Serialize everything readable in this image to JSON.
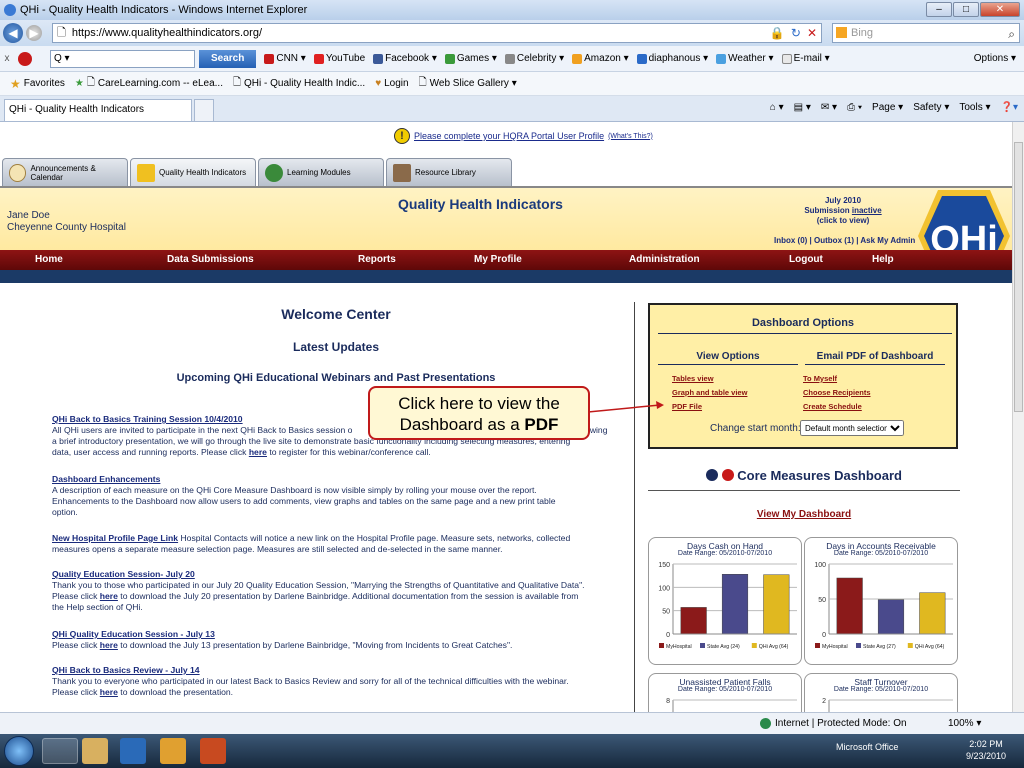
{
  "browser": {
    "window_title": "QHi - Quality Health Indicators - Windows Internet Explorer",
    "url_prefix": "https://www.",
    "url_domain": "qualityhealthindicators.org/",
    "search_placeholder": "Bing",
    "toolbar": {
      "search_label": "Search",
      "items": [
        "CNN ▾",
        "YouTube",
        "Facebook ▾",
        "Games ▾",
        "Celebrity ▾",
        "Amazon ▾",
        "diaphanous ▾",
        "Weather ▾",
        "E-mail ▾"
      ],
      "options": "Options ▾"
    },
    "favorites": {
      "label": "Favorites",
      "items": [
        "CareLearning.com -- eLea...",
        "QHi - Quality Health Indic...",
        "Login",
        "Web Slice Gallery ▾"
      ]
    },
    "tab_label": "QHi - Quality Health Indicators",
    "commands": [
      "Page ▾",
      "Safety ▾",
      "Tools ▾"
    ],
    "status": {
      "zone": "Internet | Protected Mode: On",
      "zoom": "100% ▾"
    }
  },
  "notice": {
    "text": "Please complete your HQRA Portal User Profile",
    "small": "(What's This?)"
  },
  "app_tabs": [
    "Announcements & Calendar",
    "Quality Health Indicators",
    "Learning Modules",
    "Resource Library"
  ],
  "header": {
    "user_name": "Jane Doe",
    "hospital": "Cheyenne County Hospital",
    "title": "Quality Health Indicators",
    "submission_line1": "July 2010",
    "submission_line2a": "Submission ",
    "submission_line2b": "inactive",
    "submission_line3": "(click to view)",
    "inbox": "Inbox (0) | Outbox (1) | Ask My Admin",
    "logo_text": "QHi"
  },
  "menu": [
    "Home",
    "Data Submissions",
    "Reports",
    "My Profile",
    "Administration",
    "Logout",
    "Help"
  ],
  "welcome": {
    "title": "Welcome Center",
    "latest": "Latest Updates",
    "upcoming": "Upcoming QHi Educational Webinars and Past Presentations",
    "news": [
      {
        "title": "QHi Back to Basics Training Session 10/4/2010",
        "body1": "All QHi users are invited to participate in the next QHi Back to Basics session o",
        "body1b": "ollowing",
        "body2": "a brief introductory presentation, we will go through the live site to demonstrate basic functionality including selecting measures, entering",
        "body3": "data, user access and running reports. Please click ",
        "link": "here",
        "body4": " to register for this webinar/conference call."
      },
      {
        "title": "Dashboard Enhancements",
        "body1": "A description of each measure on the QHi Core Measure Dashboard is now visible simply by rolling your mouse over the report.",
        "body2": "Enhancements to the Dashboard now allow users to add comments, view graphs and tables on the same page and a new print table",
        "body3": "option."
      },
      {
        "title": "New Hospital Profile Page Link",
        "body1": " Hospital Contacts will notice a new link on the Hospital Profile page. Measure sets, networks, collected",
        "body2": "measures opens a separate measure selection page. Measures are still selected and de-selected in the same manner."
      },
      {
        "title": "Quality Education Session- July 20",
        "body1": "Thank you to those who participated in our July 20 Quality Education Session, \"Marrying the Strengths of Quantitative and Qualitative Data\".",
        "body2a": "Please click ",
        "link": "here",
        "body2b": " to download the July 20 presentation by Darlene Bainbridge. Additional documentation from the session is available from",
        "body3": "the Help section of QHi."
      },
      {
        "title": "QHi Quality Education Session - July 13",
        "body1a": "Please click ",
        "link": "here",
        "body1b": " to download the July 13 presentation by Darlene Bainbridge, \"Moving from Incidents to Great Catches\"."
      },
      {
        "title": "QHi Back to Basics Review - July 14",
        "body1": "Thank you to everyone who participated in our latest Back to Basics Review and sorry for all of the technical difficulties with the webinar.",
        "body2a": "Please click ",
        "link": "here",
        "body2b": " to download the presentation."
      }
    ]
  },
  "dashboard_options": {
    "title": "Dashboard Options",
    "view_title": "View Options",
    "email_title": "Email PDF of Dashboard",
    "view_links": [
      "Tables view",
      "Graph and table view",
      "PDF File"
    ],
    "email_links": [
      "To Myself",
      "Choose Recipients",
      "Create Schedule"
    ],
    "start_label": "Change start month:",
    "start_value": "Default month selection"
  },
  "core": {
    "title": "Core Measures Dashboard",
    "view_link": "View My Dashboard"
  },
  "callout": {
    "line1": "Click here to view the",
    "line2": "Dashboard as a ",
    "bold": "PDF"
  },
  "chart_data": [
    {
      "type": "bar",
      "title": "Days Cash on Hand",
      "subtitle": "Date Range: 05/2010-07/2010",
      "categories": [
        "MyHospital",
        "State Avg (24)",
        "QHi Avg (64)"
      ],
      "values": [
        57,
        128,
        127
      ],
      "ylim": [
        0,
        150
      ],
      "ticks": [
        0,
        50,
        100,
        150
      ],
      "colors": [
        "#8b1a1a",
        "#4a4a8c",
        "#e0b820"
      ],
      "grid": true
    },
    {
      "type": "bar",
      "title": "Days in Accounts Receivable",
      "subtitle": "Date Range: 05/2010-07/2010",
      "categories": [
        "MyHospital",
        "State Avg (27)",
        "QHi Avg (64)"
      ],
      "values": [
        80,
        49,
        59
      ],
      "ylim": [
        0,
        100
      ],
      "ticks": [
        0,
        50,
        100
      ],
      "colors": [
        "#8b1a1a",
        "#4a4a8c",
        "#e0b820"
      ],
      "grid": true
    },
    {
      "type": "bar",
      "title": "Unassisted Patient Falls",
      "subtitle": "Date Range: 05/2010-07/2010",
      "categories": [],
      "values": [],
      "ylim": [
        0,
        8
      ],
      "ticks": [
        8
      ],
      "colors": [],
      "grid": true
    },
    {
      "type": "bar",
      "title": "Staff Turnover",
      "subtitle": "Date Range: 05/2010-07/2010",
      "categories": [],
      "values": [],
      "ylim": [
        0,
        2
      ],
      "ticks": [
        2
      ],
      "colors": [],
      "grid": true
    }
  ],
  "taskbar": {
    "tray": "Microsoft Office",
    "time": "2:02 PM",
    "date": "9/23/2010"
  }
}
